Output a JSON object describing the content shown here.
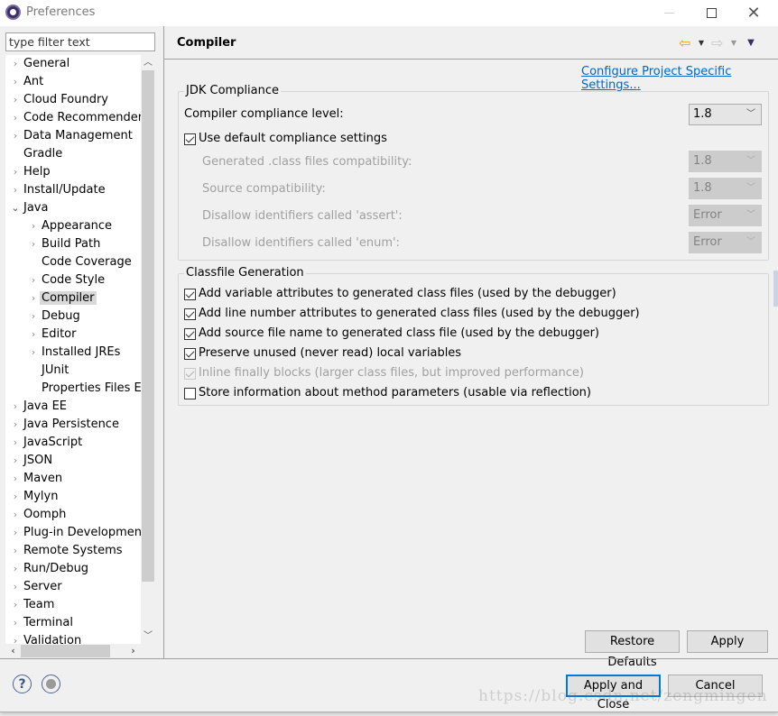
{
  "window": {
    "title": "Preferences"
  },
  "filter": {
    "placeholder": "type filter text"
  },
  "tree": {
    "items": [
      {
        "label": "General",
        "level": 0,
        "toggle": "collapsed"
      },
      {
        "label": "Ant",
        "level": 0,
        "toggle": "collapsed"
      },
      {
        "label": "Cloud Foundry",
        "level": 0,
        "toggle": "collapsed"
      },
      {
        "label": "Code Recommenders",
        "level": 0,
        "toggle": "collapsed"
      },
      {
        "label": "Data Management",
        "level": 0,
        "toggle": "collapsed"
      },
      {
        "label": "Gradle",
        "level": 0,
        "toggle": "none"
      },
      {
        "label": "Help",
        "level": 0,
        "toggle": "collapsed"
      },
      {
        "label": "Install/Update",
        "level": 0,
        "toggle": "collapsed"
      },
      {
        "label": "Java",
        "level": 0,
        "toggle": "expanded"
      },
      {
        "label": "Appearance",
        "level": 1,
        "toggle": "collapsed"
      },
      {
        "label": "Build Path",
        "level": 1,
        "toggle": "collapsed"
      },
      {
        "label": "Code Coverage",
        "level": 1,
        "toggle": "none"
      },
      {
        "label": "Code Style",
        "level": 1,
        "toggle": "collapsed"
      },
      {
        "label": "Compiler",
        "level": 1,
        "toggle": "collapsed",
        "selected": true
      },
      {
        "label": "Debug",
        "level": 1,
        "toggle": "collapsed"
      },
      {
        "label": "Editor",
        "level": 1,
        "toggle": "collapsed"
      },
      {
        "label": "Installed JREs",
        "level": 1,
        "toggle": "collapsed"
      },
      {
        "label": "JUnit",
        "level": 1,
        "toggle": "none"
      },
      {
        "label": "Properties Files Editor",
        "level": 1,
        "toggle": "none"
      },
      {
        "label": "Java EE",
        "level": 0,
        "toggle": "collapsed"
      },
      {
        "label": "Java Persistence",
        "level": 0,
        "toggle": "collapsed"
      },
      {
        "label": "JavaScript",
        "level": 0,
        "toggle": "collapsed"
      },
      {
        "label": "JSON",
        "level": 0,
        "toggle": "collapsed"
      },
      {
        "label": "Maven",
        "level": 0,
        "toggle": "collapsed"
      },
      {
        "label": "Mylyn",
        "level": 0,
        "toggle": "collapsed"
      },
      {
        "label": "Oomph",
        "level": 0,
        "toggle": "collapsed"
      },
      {
        "label": "Plug-in Development",
        "level": 0,
        "toggle": "collapsed"
      },
      {
        "label": "Remote Systems",
        "level": 0,
        "toggle": "collapsed"
      },
      {
        "label": "Run/Debug",
        "level": 0,
        "toggle": "collapsed"
      },
      {
        "label": "Server",
        "level": 0,
        "toggle": "collapsed"
      },
      {
        "label": "Team",
        "level": 0,
        "toggle": "collapsed"
      },
      {
        "label": "Terminal",
        "level": 0,
        "toggle": "collapsed"
      },
      {
        "label": "Validation",
        "level": 0,
        "toggle": "collapsed"
      }
    ]
  },
  "page": {
    "title": "Compiler",
    "config_link": "Configure Project Specific Settings..."
  },
  "jdk": {
    "legend": "JDK Compliance",
    "compliance_label": "Compiler compliance level:",
    "compliance_value": "1.8",
    "use_default": {
      "label": "Use default compliance settings",
      "checked": true
    },
    "rows": [
      {
        "label": "Generated .class files compatibility:",
        "value": "1.8"
      },
      {
        "label": "Source compatibility:",
        "value": "1.8"
      },
      {
        "label": "Disallow identifiers called 'assert':",
        "value": "Error"
      },
      {
        "label": "Disallow identifiers called 'enum':",
        "value": "Error"
      }
    ]
  },
  "classfile": {
    "legend": "Classfile Generation",
    "options": [
      {
        "label": "Add variable attributes to generated class files (used by the debugger)",
        "checked": true,
        "enabled": true
      },
      {
        "label": "Add line number attributes to generated class files (used by the debugger)",
        "checked": true,
        "enabled": true
      },
      {
        "label": "Add source file name to generated class file (used by the debugger)",
        "checked": true,
        "enabled": true
      },
      {
        "label": "Preserve unused (never read) local variables",
        "checked": true,
        "enabled": true
      },
      {
        "label": "Inline finally blocks (larger class files, but improved performance)",
        "checked": true,
        "enabled": false
      },
      {
        "label": "Store information about method parameters (usable via reflection)",
        "checked": false,
        "enabled": true
      }
    ]
  },
  "buttons": {
    "restore_defaults": "Restore Defaults",
    "apply": "Apply",
    "apply_and_close": "Apply and Close",
    "cancel": "Cancel"
  },
  "icons": {
    "help": "?"
  },
  "watermark": "https://blog.csdn.net/zengmingen",
  "colors": {
    "link": "#0066cc",
    "default_button_border": "#0078d7",
    "selection": "#d9d9d9"
  }
}
